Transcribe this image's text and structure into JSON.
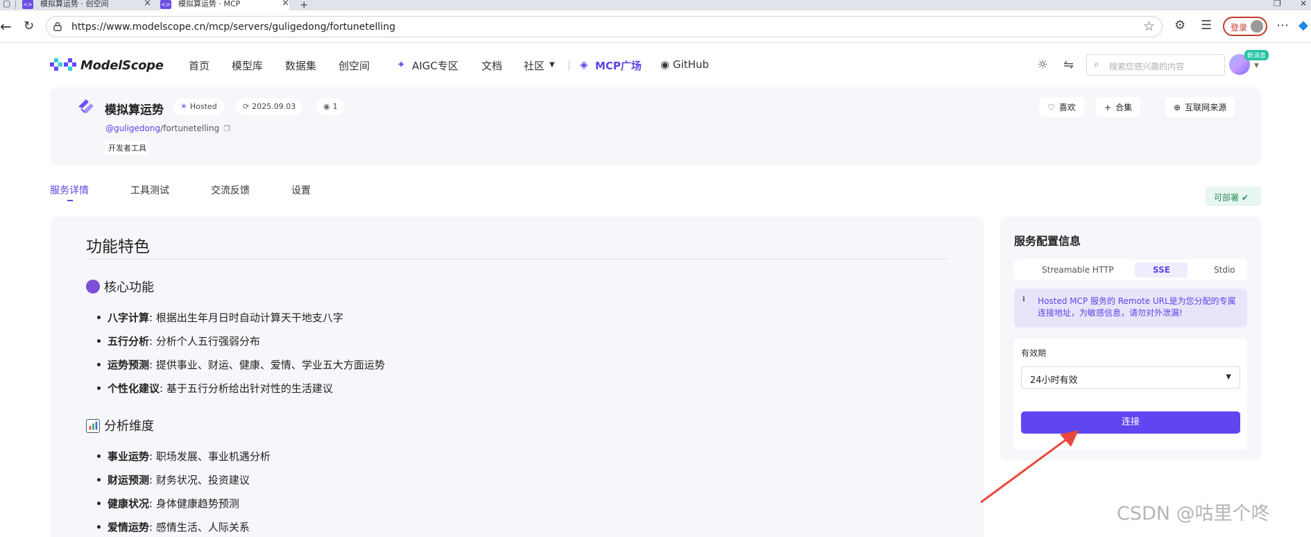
{
  "browser": {
    "tabs": [
      {
        "title": "模拟算运势 · 创空间",
        "close": "×"
      },
      {
        "title": "模拟算运势 · MCP",
        "close": "×"
      }
    ],
    "new_tab": "+",
    "url": "https://www.modelscope.cn/mcp/servers/guligedong/fortunetelling",
    "login_label": "登录"
  },
  "site": {
    "logo_text": "ModelScope",
    "nav": [
      "首页",
      "模型库",
      "数据集",
      "创空间",
      "AIGC专区",
      "文档",
      "社区",
      "MCP广场",
      "GitHub"
    ],
    "search_placeholder": "搜索您感兴趣的内容",
    "new_msg_badge": "新消息"
  },
  "server": {
    "name": "模拟算运势",
    "hosted_label": "Hosted",
    "date": "2025.09.03",
    "views": "1",
    "owner": "@guligedong",
    "repo": "/fortunetelling",
    "tag": "开发者工具",
    "actions": {
      "like": "喜欢",
      "collection": "合集",
      "internet_source": "互联网来源"
    }
  },
  "tabs": {
    "items": [
      "服务详情",
      "工具测试",
      "交流反馈",
      "设置"
    ],
    "active_index": 0,
    "deployable": "可部署"
  },
  "content": {
    "heading": "功能特色",
    "sections": [
      {
        "title": "核心功能",
        "items": [
          {
            "bold": "八字计算",
            "text": ": 根据出生年月日时自动计算天干地支八字"
          },
          {
            "bold": "五行分析",
            "text": ": 分析个人五行强弱分布"
          },
          {
            "bold": "运势预测",
            "text": ": 提供事业、财运、健康、爱情、学业五大方面运势"
          },
          {
            "bold": "个性化建议",
            "text": ": 基于五行分析给出针对性的生活建议"
          }
        ]
      },
      {
        "title": "分析维度",
        "items": [
          {
            "bold": "事业运势",
            "text": ": 职场发展、事业机遇分析"
          },
          {
            "bold": "财运预测",
            "text": ": 财务状况、投资建议"
          },
          {
            "bold": "健康状况",
            "text": ": 身体健康趋势预测"
          },
          {
            "bold": "爱情运势",
            "text": ": 感情生活、人际关系"
          }
        ]
      }
    ]
  },
  "config": {
    "title": "服务配置信息",
    "transports": [
      "Streamable HTTP",
      "SSE",
      "Stdio"
    ],
    "active_transport": "SSE",
    "notice": "Hosted MCP 服务的 Remote URL是为您分配的专属连接地址，为敏感信息，请勿对外泄漏!",
    "validity_label": "有效期",
    "validity_value": "24小时有效",
    "connect_label": "连接"
  },
  "watermark": "CSDN @咕里个咚",
  "colors": {
    "accent": "#6046f0",
    "panel_bg": "#f6f7fa",
    "annotation_arrow": "#e8483c"
  }
}
